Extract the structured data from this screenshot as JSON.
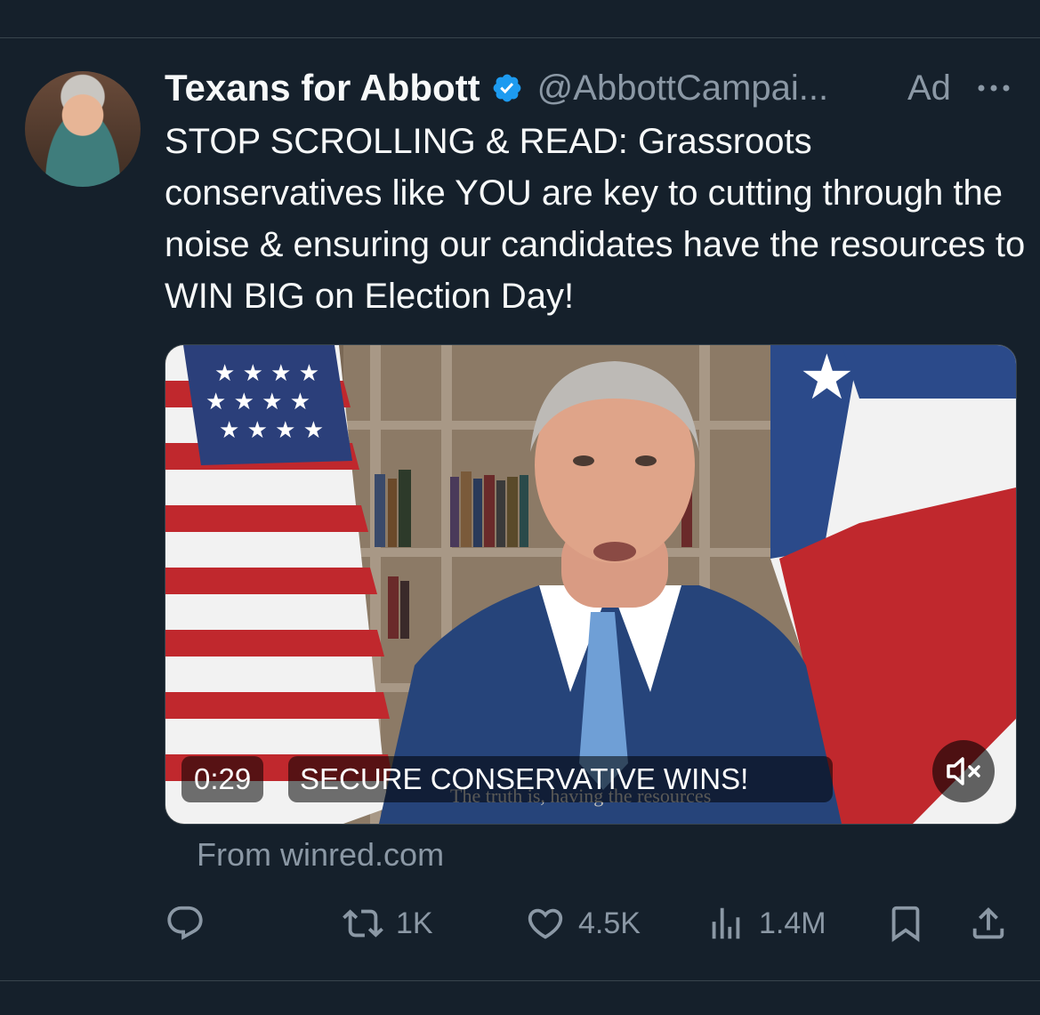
{
  "tweet": {
    "display_name": "Texans for Abbott",
    "handle": "@AbbottCampai...",
    "ad_label": "Ad",
    "text": "STOP SCROLLING & READ: Grassroots conservatives like YOU are key to cutting through the noise & ensuring our candidates have the resources to WIN BIG on Election Day!",
    "source": "From winred.com"
  },
  "video": {
    "timecode": "0:29",
    "headline": "SECURE CONSERVATIVE WINS!",
    "subtitle": "The truth is, having the resources",
    "muted": true
  },
  "actions": {
    "reply_icon": "reply-icon",
    "retweet_count": "1K",
    "like_count": "4.5K",
    "views_count": "1.4M",
    "bookmark_icon": "bookmark-icon",
    "share_icon": "share-icon"
  },
  "colors": {
    "background": "#15202b",
    "text_primary": "#f7f9f9",
    "text_secondary": "#8b98a5",
    "verified_blue": "#1d9bf0",
    "divider": "#38444d"
  }
}
